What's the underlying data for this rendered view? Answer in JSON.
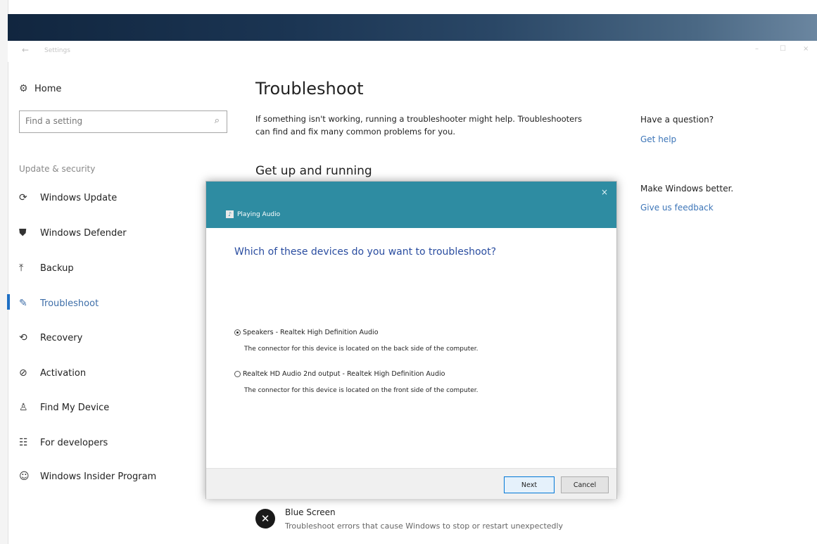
{
  "window": {
    "title": "Settings",
    "back_icon": "←",
    "minimize_icon": "–",
    "maximize_icon": "☐",
    "close_icon": "×"
  },
  "nav": {
    "home": "Home",
    "search": {
      "placeholder": "Find a setting"
    },
    "section_label": "Update & security",
    "items": [
      {
        "label": "Windows Update",
        "icon": "⟳"
      },
      {
        "label": "Windows Defender",
        "icon": "⛊"
      },
      {
        "label": "Backup",
        "icon": "⤒"
      },
      {
        "label": "Troubleshoot",
        "icon": "✎",
        "active": true
      },
      {
        "label": "Recovery",
        "icon": "⟲"
      },
      {
        "label": "Activation",
        "icon": "⊘"
      },
      {
        "label": "Find My Device",
        "icon": "♙"
      },
      {
        "label": "For developers",
        "icon": "☷"
      },
      {
        "label": "Windows Insider Program",
        "icon": "☺"
      }
    ]
  },
  "main": {
    "title": "Troubleshoot",
    "intro": "If something isn't working, running a troubleshooter might help. Troubleshooters can find and fix many common problems for you.",
    "subhead": "Get up and running",
    "blue_screen": {
      "title": "Blue Screen",
      "desc": "Troubleshoot errors that cause Windows to stop or restart unexpectedly"
    }
  },
  "right": {
    "question": "Have a question?",
    "get_help": "Get help",
    "better": "Make Windows better.",
    "feedback": "Give us feedback"
  },
  "dialog": {
    "wizard_title": "Playing Audio",
    "close": "×",
    "question": "Which of these devices do you want to troubleshoot?",
    "options": [
      {
        "label": "Speakers - Realtek High Definition Audio",
        "desc": "The connector for this device is located on the back side of the computer.",
        "selected": true
      },
      {
        "label": "Realtek HD Audio 2nd output - Realtek High Definition Audio",
        "desc": "The connector for this device is located on the front side of the computer.",
        "selected": false
      }
    ],
    "next": "Next",
    "cancel": "Cancel"
  },
  "colors": {
    "accent": "#1e6fc4",
    "dialog_header": "#2e8ca2",
    "link": "#3e76b8",
    "dialog_question": "#2a4da0"
  }
}
